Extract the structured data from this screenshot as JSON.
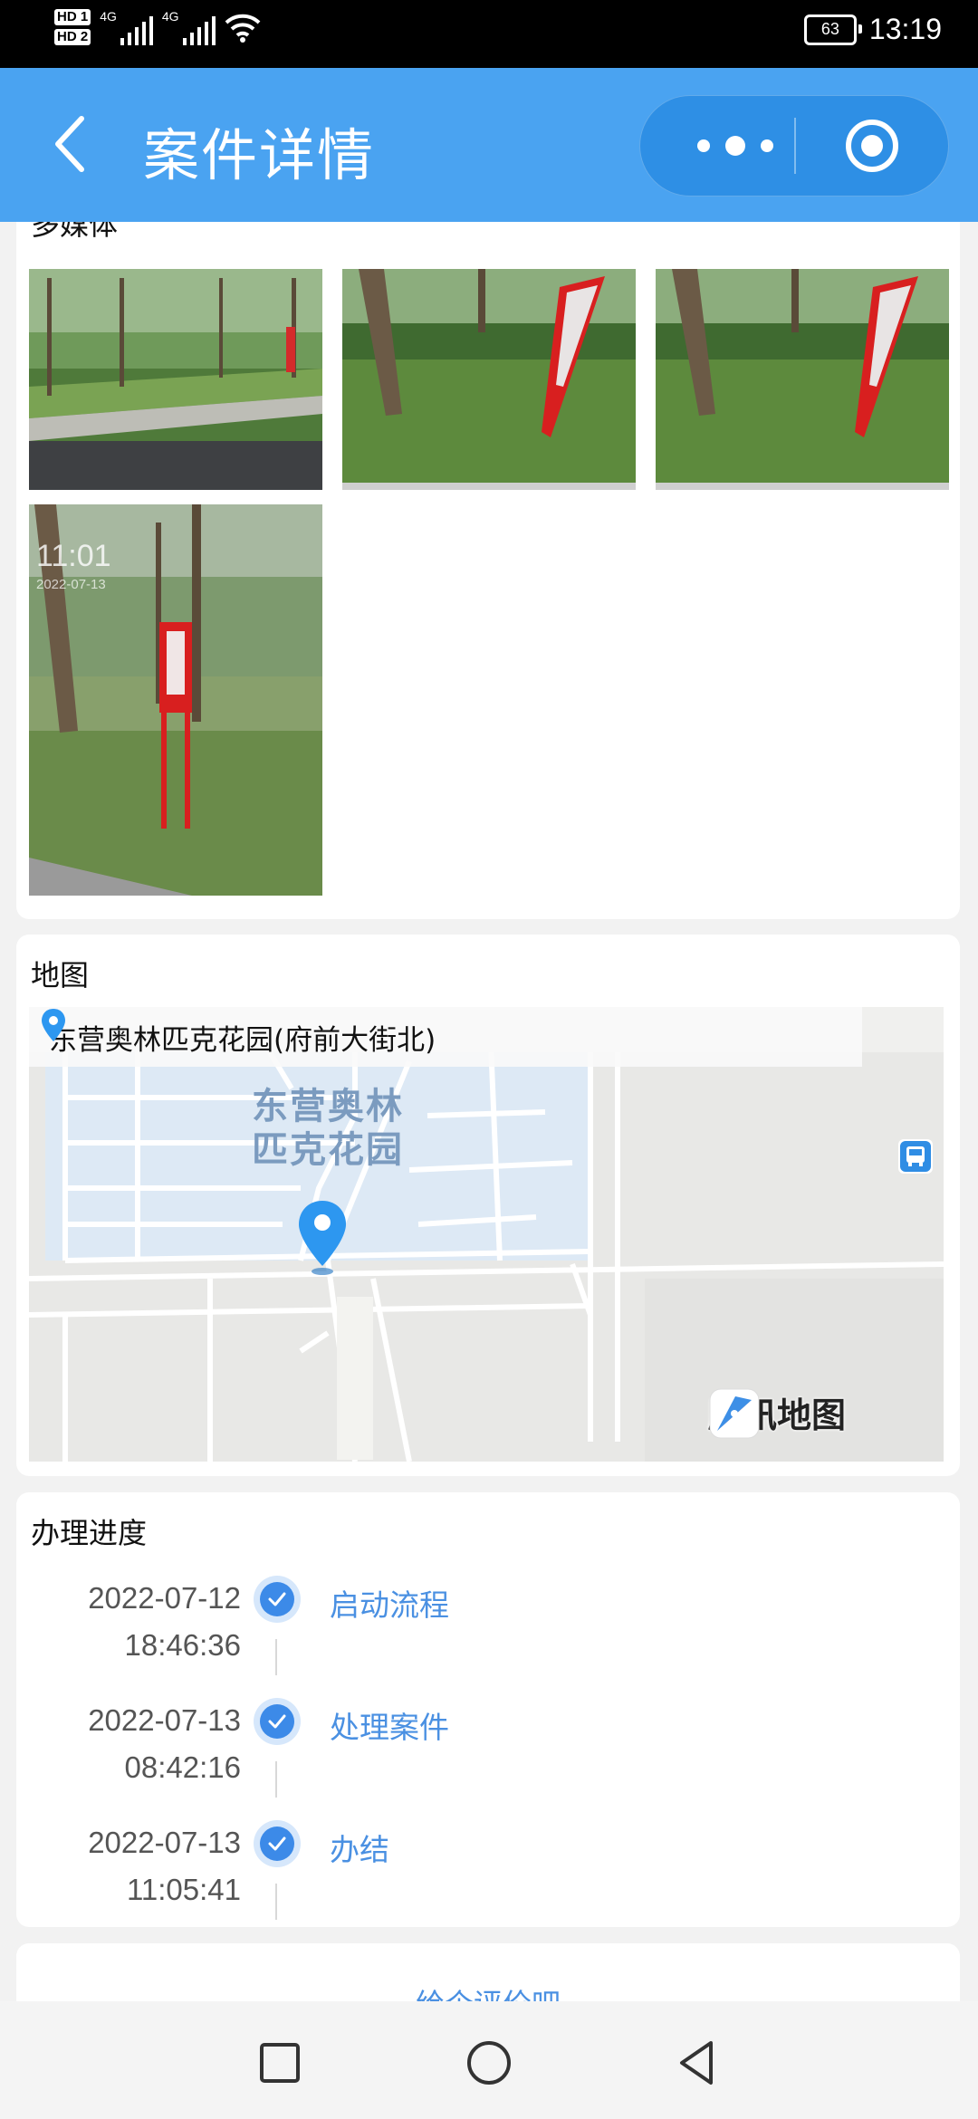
{
  "status_bar": {
    "sim1": "HD 1",
    "sim2": "HD 2",
    "net1": "4G",
    "net2": "4G",
    "battery": "63",
    "time": "13:19"
  },
  "header": {
    "title": "案件详情",
    "more_icon": "more-dots-icon",
    "close_icon": "target-circle-icon"
  },
  "media": {
    "title": "多媒体",
    "photos": [
      {
        "alt": "路边树林"
      },
      {
        "alt": "红色宣传牌"
      },
      {
        "alt": "红色宣传牌"
      },
      {
        "alt": "红色宣传牌",
        "timestamp": "11:01",
        "date": "2022-07-13"
      }
    ]
  },
  "map": {
    "title": "地图",
    "address": "东营奥林匹克花园(府前大街北)",
    "poi_label_line1": "东营奥林",
    "poi_label_line2": "匹克花园",
    "brand": "腾讯地图"
  },
  "progress": {
    "title": "办理进度",
    "steps": [
      {
        "date": "2022-07-12",
        "time": "18:46:36",
        "label": "启动流程"
      },
      {
        "date": "2022-07-13",
        "time": "08:42:16",
        "label": "处理案件"
      },
      {
        "date": "2022-07-13",
        "time": "11:05:41",
        "label": "办结"
      }
    ]
  },
  "rating": {
    "link": "给个评价吧"
  },
  "nav": {
    "recent_icon": "square-icon",
    "home_icon": "circle-icon",
    "back_icon": "triangle-back-icon"
  },
  "colors": {
    "header": "#4aa3f1",
    "accent": "#4a90e2",
    "check": "#3c8ae8"
  }
}
